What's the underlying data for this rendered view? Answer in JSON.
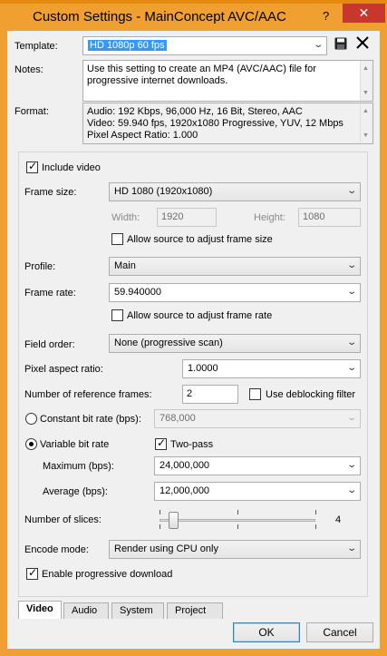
{
  "window": {
    "title": "Custom Settings - MainConcept AVC/AAC",
    "help_label": "?",
    "close_label": "✕"
  },
  "template": {
    "label": "Template:",
    "value": "HD 1080p 60 fps",
    "save_icon": "save-icon",
    "delete_icon": "delete-icon"
  },
  "notes": {
    "label": "Notes:",
    "line1": "Use this setting to create an MP4 (AVC/AAC) file for",
    "line2": "progressive internet downloads."
  },
  "format": {
    "label": "Format:",
    "line1": "Audio: 192 Kbps, 96,000 Hz, 16 Bit, Stereo, AAC",
    "line2": "Video: 59.940 fps, 1920x1080 Progressive, YUV, 12 Mbps",
    "line3": "Pixel Aspect Ratio: 1.000"
  },
  "video": {
    "include_video_label": "Include video",
    "include_video_checked": true,
    "frame_size_label": "Frame size:",
    "frame_size_value": "HD 1080 (1920x1080)",
    "width_label": "Width:",
    "width_value": "1920",
    "height_label": "Height:",
    "height_value": "1080",
    "allow_frame_size_label": "Allow source to adjust frame size",
    "profile_label": "Profile:",
    "profile_value": "Main",
    "frame_rate_label": "Frame rate:",
    "frame_rate_value": "59.940000",
    "allow_frame_rate_label": "Allow source to adjust frame rate",
    "field_order_label": "Field order:",
    "field_order_value": "None (progressive scan)",
    "pixel_aspect_label": "Pixel aspect ratio:",
    "pixel_aspect_value": "1.0000",
    "ref_frames_label": "Number of reference frames:",
    "ref_frames_value": "2",
    "deblocking_label": "Use deblocking filter",
    "cbr_label": "Constant bit rate (bps):",
    "cbr_value": "768,000",
    "vbr_label": "Variable bit rate",
    "two_pass_label": "Two-pass",
    "maximum_label": "Maximum (bps):",
    "maximum_value": "24,000,000",
    "average_label": "Average (bps):",
    "average_value": "12,000,000",
    "slices_label": "Number of slices:",
    "slices_value": "4",
    "encode_mode_label": "Encode mode:",
    "encode_mode_value": "Render using CPU only",
    "progressive_download_label": "Enable progressive download"
  },
  "tabs": [
    {
      "label": "Video"
    },
    {
      "label": "Audio"
    },
    {
      "label": "System"
    },
    {
      "label": "Project"
    }
  ],
  "buttons": {
    "ok_label": "OK",
    "cancel_label": "Cancel"
  }
}
